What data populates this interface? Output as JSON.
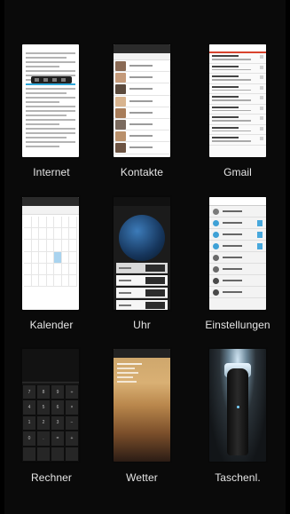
{
  "apps": [
    {
      "label": "Internet"
    },
    {
      "label": "Kontakte"
    },
    {
      "label": "Gmail"
    },
    {
      "label": "Kalender"
    },
    {
      "label": "Uhr"
    },
    {
      "label": "Einstellungen"
    },
    {
      "label": "Rechner"
    },
    {
      "label": "Wetter"
    },
    {
      "label": "Taschenl."
    }
  ]
}
